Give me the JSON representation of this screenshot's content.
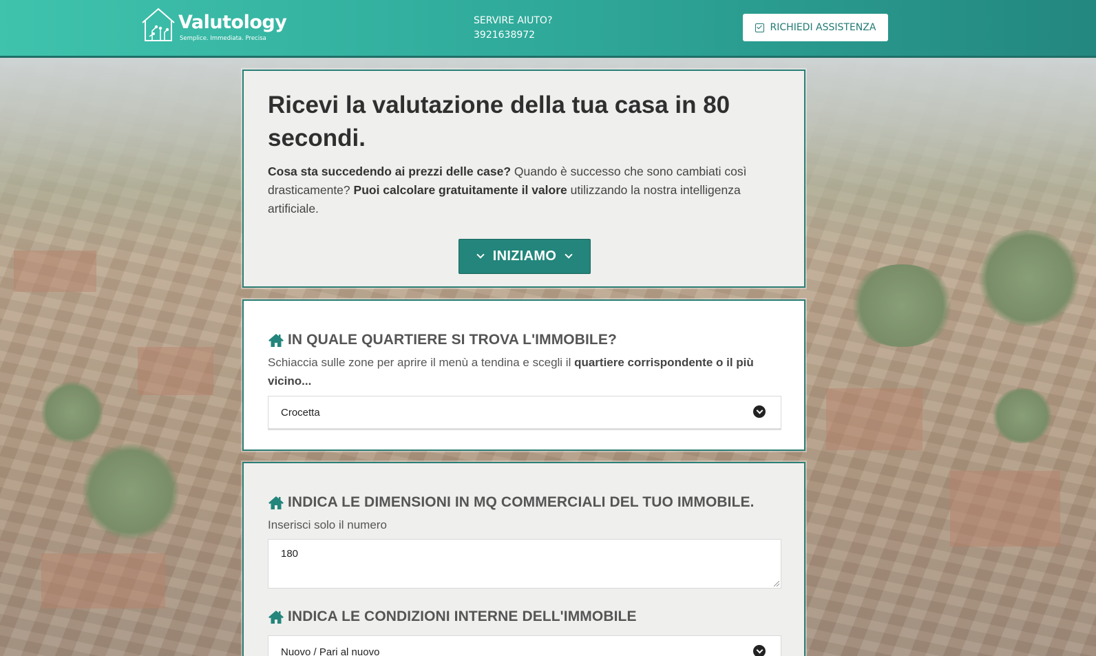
{
  "header": {
    "logo_name": "Valutology",
    "logo_tagline": "Semplice. Immediata. Precisa",
    "help_label": "SERVIRE AIUTO?",
    "help_phone": "3921638972",
    "assist_button": "RICHIEDI ASSISTENZA"
  },
  "hero": {
    "title": "Ricevi la valutazione della tua casa in 80 secondi.",
    "text_bold_1": "Cosa sta succedendo ai prezzi delle case?",
    "text_1": " Quando è successo che sono cambiati così drasticamente? ",
    "text_bold_2": "Puoi calcolare gratuitamente il valore",
    "text_2": " utilizzando la nostra intelligenza artificiale.",
    "start_button": "INIZIAMO"
  },
  "neighborhood": {
    "title": "IN QUALE QUARTIERE SI TROVA L'IMMOBILE?",
    "sub_1": "Schiaccia sulle zone per aprire il menù a tendina e scegli il ",
    "sub_bold": "quartiere corrispondente o il più vicino...",
    "selected": "Crocetta"
  },
  "size": {
    "title": "INDICA LE DIMENSIONI IN MQ COMMERCIALI DEL TUO IMMOBILE.",
    "sub": "Inserisci solo il numero",
    "value": "180"
  },
  "condition": {
    "title": "INDICA LE CONDIZIONI INTERNE DELL'IMMOBILE",
    "selected": "Nuovo / Pari al nuovo"
  },
  "colors": {
    "header_start": "#3fc3ad",
    "header_end": "#23877f",
    "accent": "#23857b",
    "card_border": "#2b7f76"
  },
  "icons": {
    "logo": "house-circuit-icon",
    "assist": "check-square-icon",
    "section": "home-icon",
    "dropdown": "chevron-circle-down-icon"
  }
}
